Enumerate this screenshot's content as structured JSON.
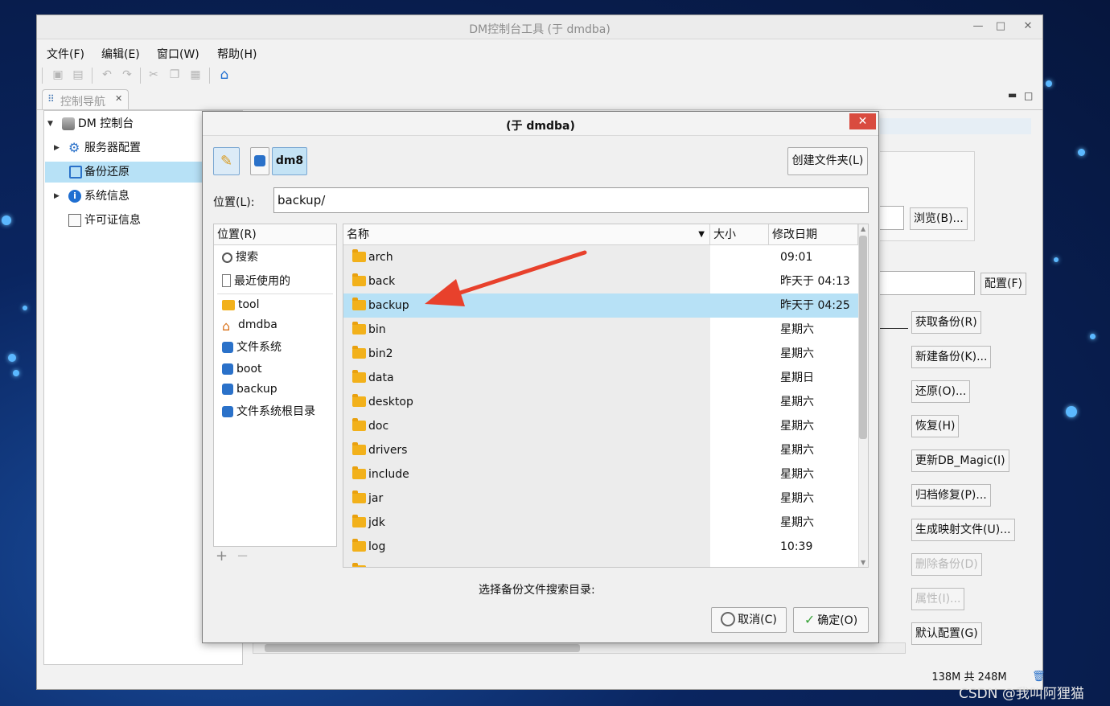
{
  "window": {
    "title": "DM控制台工具 (于 dmdba)"
  },
  "menu": [
    "文件(F)",
    "编辑(E)",
    "窗口(W)",
    "帮助(H)"
  ],
  "nav": {
    "tab_label": "控制导航",
    "tree": [
      {
        "label": "DM 控制台",
        "icon": "database-icon"
      },
      {
        "label": "服务器配置",
        "icon": "gear-icon"
      },
      {
        "label": "备份还原",
        "icon": "backup-icon"
      },
      {
        "label": "系统信息",
        "icon": "info-icon"
      },
      {
        "label": "许可证信息",
        "icon": "license-icon"
      }
    ]
  },
  "right_panel": {
    "browse": "浏览(B)...",
    "config": "配置(F)",
    "actions": [
      "获取备份(R)",
      "新建备份(K)...",
      "还原(O)...",
      "恢复(H)",
      "更新DB_Magic(I)",
      "归档修复(P)...",
      "生成映射文件(U)...",
      "删除备份(D)",
      "属性(I)...",
      "默认配置(G)"
    ],
    "disabled": [
      "删除备份(D)",
      "属性(I)..."
    ]
  },
  "status": {
    "memory": "138M 共 248M"
  },
  "dialog": {
    "title": "(于 dmdba)",
    "path_button": "dm8",
    "create_folder": "创建文件夹(L)",
    "location_label": "位置(L):",
    "location_value": "backup/",
    "places_header": "位置(R)",
    "places": [
      {
        "label": "搜索",
        "icon": "search-icon"
      },
      {
        "label": "最近使用的",
        "icon": "recent-icon"
      },
      {
        "label": "tool",
        "icon": "folder-icon"
      },
      {
        "label": "dmdba",
        "icon": "home-icon"
      },
      {
        "label": "文件系统",
        "icon": "drive-icon"
      },
      {
        "label": "boot",
        "icon": "drive-icon"
      },
      {
        "label": "backup",
        "icon": "drive-icon"
      },
      {
        "label": "文件系统根目录",
        "icon": "drive-icon"
      }
    ],
    "columns": {
      "name": "名称",
      "size": "大小",
      "modified": "修改日期"
    },
    "files": [
      {
        "name": "arch",
        "modified": "09:01"
      },
      {
        "name": "back",
        "modified": "昨天于 04:13"
      },
      {
        "name": "backup",
        "modified": "昨天于 04:25",
        "selected": true
      },
      {
        "name": "bin",
        "modified": "星期六"
      },
      {
        "name": "bin2",
        "modified": "星期六"
      },
      {
        "name": "data",
        "modified": "星期日"
      },
      {
        "name": "desktop",
        "modified": "星期六"
      },
      {
        "name": "doc",
        "modified": "星期六"
      },
      {
        "name": "drivers",
        "modified": "星期六"
      },
      {
        "name": "include",
        "modified": "星期六"
      },
      {
        "name": "jar",
        "modified": "星期六"
      },
      {
        "name": "jdk",
        "modified": "星期六"
      },
      {
        "name": "log",
        "modified": "10:39"
      }
    ],
    "hint": "选择备份文件搜索目录:",
    "cancel": "取消(C)",
    "ok": "确定(O)"
  },
  "watermark": "CSDN @我叫阿狸猫",
  "colors": {
    "selection": "#b7e1f6",
    "close_button": "#d94b3f",
    "arrow": "#e8412c",
    "folder": "#f2b11b"
  }
}
